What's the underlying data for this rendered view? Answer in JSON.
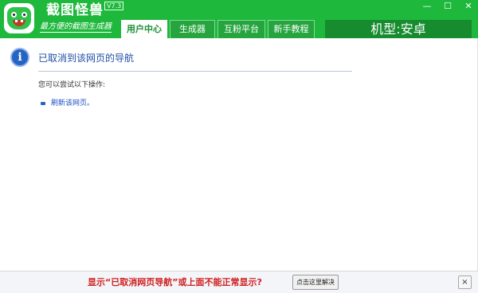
{
  "app": {
    "name": "截图怪兽",
    "version": "V7.3",
    "slogan": "最方便的截图生成器"
  },
  "tabs": [
    {
      "label": "用户中心",
      "active": true
    },
    {
      "label": "生成器",
      "active": false
    },
    {
      "label": "互粉平台",
      "active": false
    },
    {
      "label": "新手教程",
      "active": false
    }
  ],
  "model_label": "机型:安卓",
  "window_controls": {
    "minimize": "—",
    "maximize": "☐",
    "close": "✕"
  },
  "page": {
    "icon_glyph": "i",
    "error_title": "已取消到该网页的导航",
    "try_text": "您可以尝试以下操作:",
    "refresh_link": "刷新该网页。"
  },
  "notice": {
    "message": "显示“已取消网页导航”或上面不能正常显示?",
    "fix_button": "点击这里解决",
    "close": "×"
  },
  "colors": {
    "brand_green": "#1eb83c",
    "model_green": "#178c2f",
    "link_blue": "#1a4fc4",
    "notice_red": "#d01e1e"
  }
}
